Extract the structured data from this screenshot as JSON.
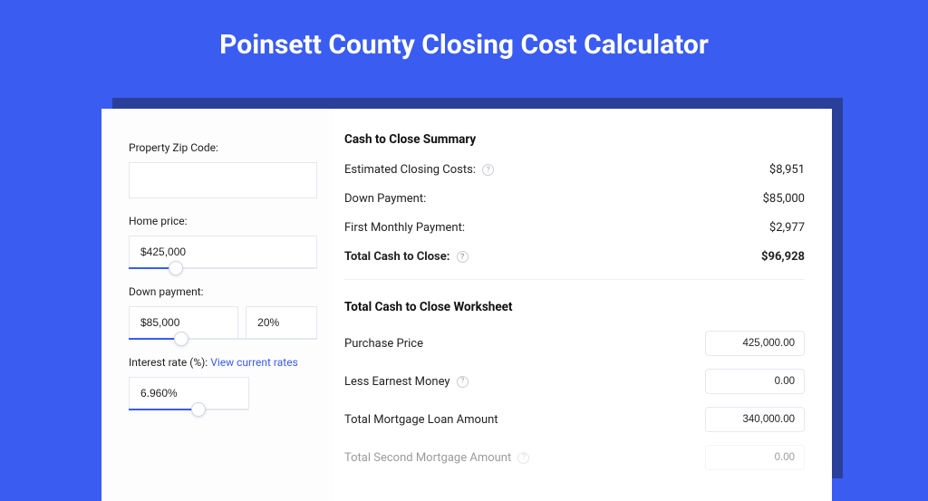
{
  "page": {
    "title": "Poinsett County Closing Cost Calculator"
  },
  "inputs": {
    "zip_label": "Property Zip Code:",
    "zip_value": "",
    "home_price_label": "Home price:",
    "home_price_value": "$425,000",
    "home_price_slider_pct": 25,
    "down_payment_label": "Down payment:",
    "down_payment_value": "$85,000",
    "down_payment_pct": "20%",
    "down_payment_slider_pct": 28,
    "rate_label": "Interest rate (%):",
    "rate_link": "View current rates",
    "rate_value": "6.960%",
    "rate_slider_pct": 58
  },
  "summary": {
    "heading": "Cash to Close Summary",
    "rows": [
      {
        "label": "Estimated Closing Costs:",
        "value": "$8,951",
        "help": true
      },
      {
        "label": "Down Payment:",
        "value": "$85,000",
        "help": false
      },
      {
        "label": "First Monthly Payment:",
        "value": "$2,977",
        "help": false
      }
    ],
    "total_label": "Total Cash to Close:",
    "total_value": "$96,928"
  },
  "worksheet": {
    "heading": "Total Cash to Close Worksheet",
    "rows": [
      {
        "label": "Purchase Price",
        "value": "425,000.00",
        "help": false
      },
      {
        "label": "Less Earnest Money",
        "value": "0.00",
        "help": true
      },
      {
        "label": "Total Mortgage Loan Amount",
        "value": "340,000.00",
        "help": false
      },
      {
        "label": "Total Second Mortgage Amount",
        "value": "0.00",
        "help": true
      }
    ]
  }
}
